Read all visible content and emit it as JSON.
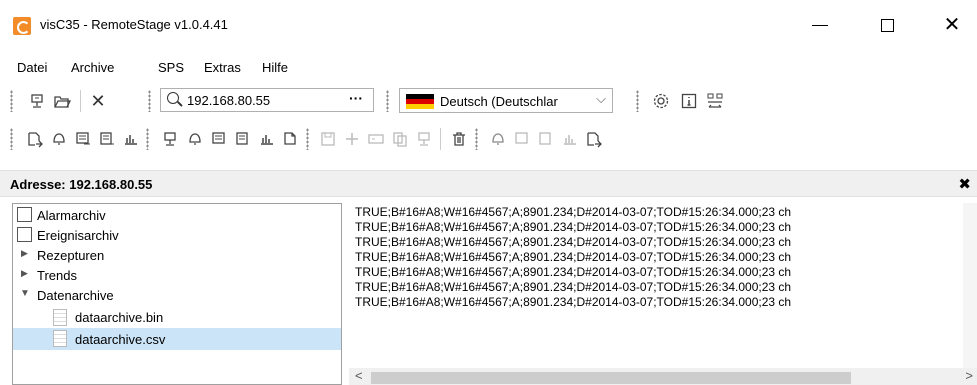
{
  "window": {
    "title": "visC35 - RemoteStage v1.0.4.41",
    "min_label": "",
    "max_label": "",
    "close_label": "✕"
  },
  "menu": {
    "items": [
      "Datei",
      "Archive",
      "SPS",
      "Extras",
      "Hilfe"
    ]
  },
  "toolbar1": {
    "address_value": "192.168.80.55",
    "address_more": "···",
    "language_value": "Deutsch (Deutschlar",
    "language_chevron": "⌵"
  },
  "address_header": {
    "label": "Adresse: 192.168.80.55",
    "close": "✖"
  },
  "tree": {
    "items": [
      {
        "label": "Alarmarchiv",
        "icon": "bell-icon"
      },
      {
        "label": "Ereignisarchiv",
        "icon": "event-icon"
      },
      {
        "label": "Rezepturen",
        "icon": "collapsed-arrow"
      },
      {
        "label": "Trends",
        "icon": "collapsed-arrow"
      },
      {
        "label": "Datenarchive",
        "icon": "expanded-arrow"
      },
      {
        "label": "dataarchive.bin",
        "icon": "file-icon"
      },
      {
        "label": "dataarchive.csv",
        "icon": "file-icon"
      }
    ]
  },
  "content": {
    "lines": [
      "TRUE;B#16#A8;W#16#4567;A;8901.234;D#2014-03-07;TOD#15:26:34.000;23 ch",
      "TRUE;B#16#A8;W#16#4567;A;8901.234;D#2014-03-07;TOD#15:26:34.000;23 ch",
      "TRUE;B#16#A8;W#16#4567;A;8901.234;D#2014-03-07;TOD#15:26:34.000;23 ch",
      "TRUE;B#16#A8;W#16#4567;A;8901.234;D#2014-03-07;TOD#15:26:34.000;23 ch",
      "TRUE;B#16#A8;W#16#4567;A;8901.234;D#2014-03-07;TOD#15:26:34.000;23 ch",
      "TRUE;B#16#A8;W#16#4567;A;8901.234;D#2014-03-07;TOD#15:26:34.000;23 ch",
      "TRUE;B#16#A8;W#16#4567;A;8901.234;D#2014-03-07;TOD#15:26:34.000;23 ch"
    ]
  },
  "colors": {
    "app_icon": "#f28c28",
    "selection": "#cce4f7",
    "flag_black": "#000000",
    "flag_red": "#dd0000",
    "flag_gold": "#ffce00"
  }
}
